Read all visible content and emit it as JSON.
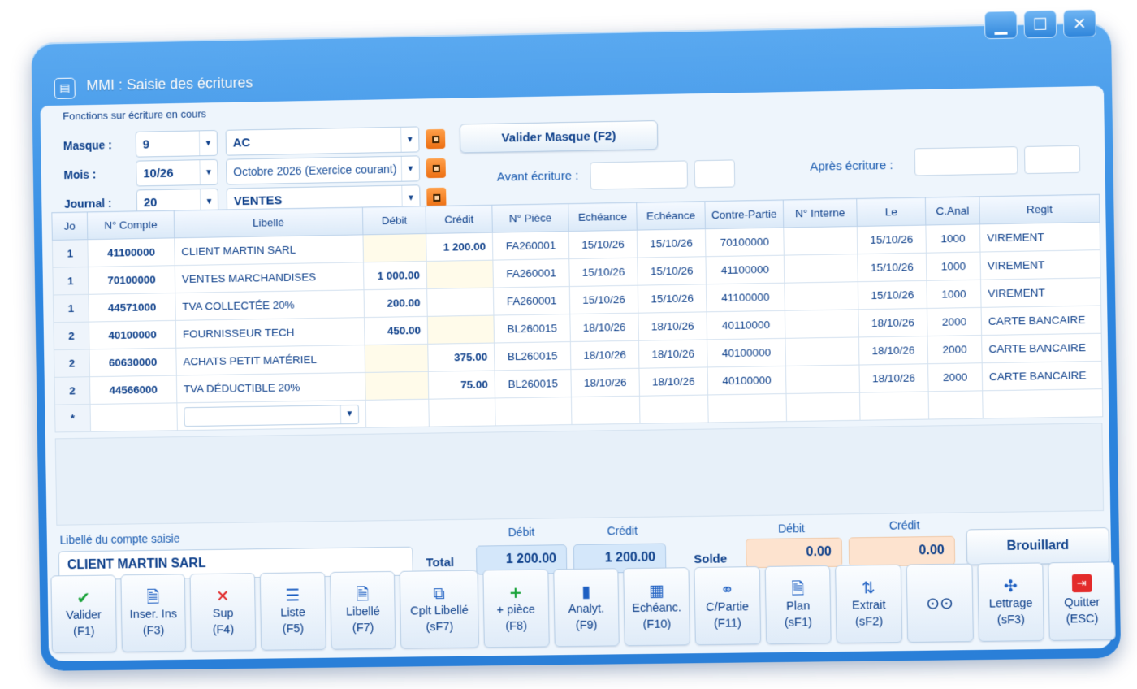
{
  "window": {
    "title": "MMI : Saisie des écritures",
    "minimize": "▁",
    "maximize": "☐",
    "close": "✕"
  },
  "header": {
    "section_label": "Fonctions sur écriture en cours",
    "masque_label": "Masque :",
    "masque_code": "9",
    "masque_name": "AC",
    "mois_label": "Mois :",
    "mois_value": "10/26",
    "mois_name": "Octobre 2026 (Exercice courant)",
    "journal_label": "Journal :",
    "journal_code": "20",
    "journal_name": "VENTES",
    "valider_masque": "Valider Masque (F2)",
    "avant_label": "Avant écriture :",
    "apres_label": "Après écriture :"
  },
  "grid": {
    "columns": [
      "Jo",
      "N° Compte",
      "Libellé",
      "Débit",
      "Crédit",
      "N° Pièce",
      "Echéance",
      "Echéance",
      "Contre-Partie",
      "N° Interne",
      "Le",
      "C.Anal",
      "Reglt"
    ],
    "rows": [
      {
        "jo": "1",
        "compte": "41100000",
        "libelle": "CLIENT MARTIN SARL",
        "debit": "",
        "credit": "1 200.00",
        "piece": "FA260001",
        "ech1": "15/10/26",
        "ech2": "15/10/26",
        "contre": "70100000",
        "interne": "",
        "le": "15/10/26",
        "canal": "1000",
        "reglt": "VIREMENT"
      },
      {
        "jo": "1",
        "compte": "70100000",
        "libelle": "VENTES MARCHANDISES",
        "debit": "1 000.00",
        "credit": "",
        "piece": "FA260001",
        "ech1": "15/10/26",
        "ech2": "15/10/26",
        "contre": "41100000",
        "interne": "",
        "le": "15/10/26",
        "canal": "1000",
        "reglt": "VIREMENT"
      },
      {
        "jo": "1",
        "compte": "44571000",
        "libelle": "TVA COLLECTÉE 20%",
        "debit": "200.00",
        "credit": "",
        "piece": "FA260001",
        "ech1": "15/10/26",
        "ech2": "15/10/26",
        "contre": "41100000",
        "interne": "",
        "le": "15/10/26",
        "canal": "1000",
        "reglt": "VIREMENT"
      },
      {
        "jo": "2",
        "compte": "40100000",
        "libelle": "FOURNISSEUR TECH",
        "debit": "450.00",
        "credit": "",
        "piece": "BL260015",
        "ech1": "18/10/26",
        "ech2": "18/10/26",
        "contre": "40110000",
        "interne": "",
        "le": "18/10/26",
        "canal": "2000",
        "reglt": "CARTE BANCAIRE"
      },
      {
        "jo": "2",
        "compte": "60630000",
        "libelle": "ACHATS PETIT MATÉRIEL",
        "debit": "",
        "credit": "375.00",
        "piece": "BL260015",
        "ech1": "18/10/26",
        "ech2": "18/10/26",
        "contre": "40100000",
        "interne": "",
        "le": "18/10/26",
        "canal": "2000",
        "reglt": "CARTE BANCAIRE"
      },
      {
        "jo": "2",
        "compte": "44566000",
        "libelle": "TVA DÉDUCTIBLE 20%",
        "debit": "",
        "credit": "75.00",
        "piece": "BL260015",
        "ech1": "18/10/26",
        "ech2": "18/10/26",
        "contre": "40100000",
        "interne": "",
        "le": "18/10/26",
        "canal": "2000",
        "reglt": "CARTE BANCAIRE"
      }
    ],
    "new_row_marker": "*"
  },
  "footer": {
    "libelle_label": "Libellé du compte saisie",
    "libelle_value": "CLIENT MARTIN SARL",
    "total_label": "Total",
    "debit_header": "Débit",
    "credit_header": "Crédit",
    "total_debit": "1 200.00",
    "total_credit": "1 200.00",
    "solde_label": "Solde",
    "solde_debit": "0.00",
    "solde_credit": "0.00",
    "brouillard": "Brouillard"
  },
  "toolbar": [
    {
      "icon": "✔",
      "l1": "Valider",
      "l2": "(F1)"
    },
    {
      "icon": "🗎",
      "l1": "Inser. Ins",
      "l2": "(F3)"
    },
    {
      "icon": "✕",
      "l1": "Sup",
      "l2": "(F4)"
    },
    {
      "icon": "☰",
      "l1": "Liste",
      "l2": "(F5)"
    },
    {
      "icon": "🗎",
      "l1": "Libellé",
      "l2": "(F7)"
    },
    {
      "icon": "⧉",
      "l1": "Cplt Libellé",
      "l2": "(sF7)"
    },
    {
      "icon": "+",
      "l1": "+ pièce",
      "l2": "(F8)"
    },
    {
      "icon": "▮",
      "l1": "Analyt.",
      "l2": "(F9)"
    },
    {
      "icon": "▦",
      "l1": "Echéanc.",
      "l2": "(F10)"
    },
    {
      "icon": "⚭",
      "l1": "C/Partie",
      "l2": "(F11)"
    },
    {
      "icon": "🗎",
      "l1": "Plan",
      "l2": "(sF1)"
    },
    {
      "icon": "⇅",
      "l1": "Extrait",
      "l2": "(sF2)"
    },
    {
      "icon": "⊙⊙",
      "l1": "",
      "l2": ""
    },
    {
      "icon": "✣",
      "l1": "Lettrage",
      "l2": "(sF3)"
    },
    {
      "icon": "⇥",
      "l1": "Quitter",
      "l2": "(ESC)"
    }
  ]
}
